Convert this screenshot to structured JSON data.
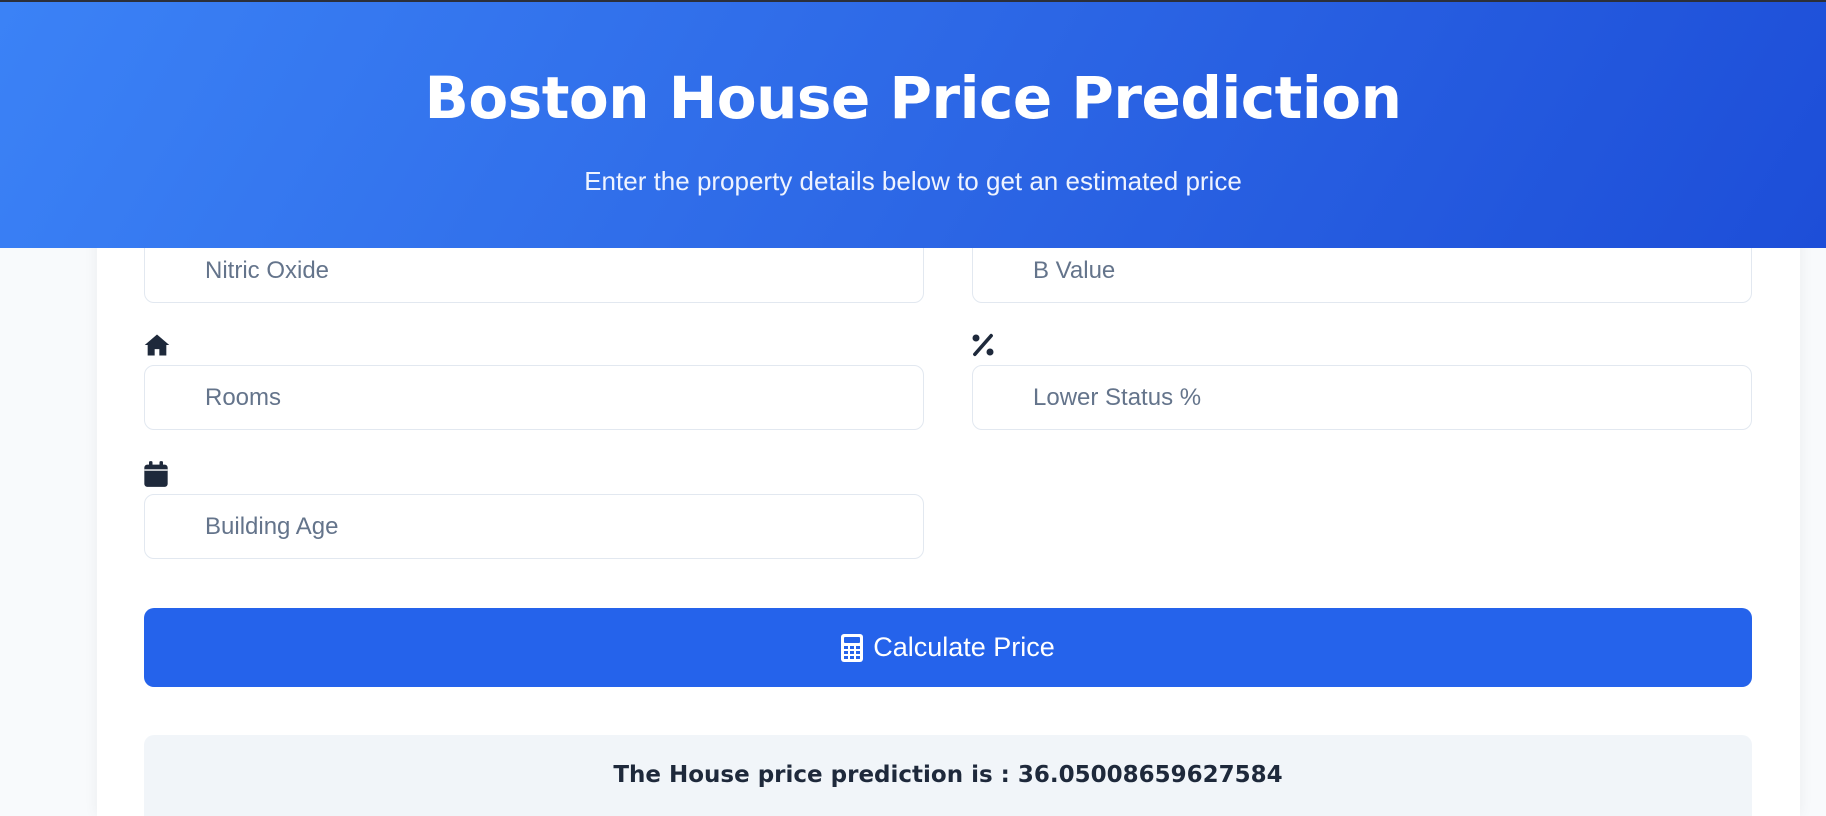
{
  "header": {
    "title": "Boston House Price Prediction",
    "subtitle": "Enter the property details below to get an estimated price"
  },
  "form": {
    "nitric_oxide": {
      "placeholder": "Nitric Oxide",
      "value": ""
    },
    "b_value": {
      "placeholder": "B Value",
      "value": ""
    },
    "rooms": {
      "placeholder": "Rooms",
      "value": "",
      "icon": "house-icon"
    },
    "lower_status": {
      "placeholder": "Lower Status %",
      "value": "",
      "icon": "percent-icon"
    },
    "building_age": {
      "placeholder": "Building Age",
      "value": "",
      "icon": "calendar-icon"
    }
  },
  "submit": {
    "label": "Calculate Price",
    "icon": "calculator-icon"
  },
  "result": {
    "text": "The House price prediction is : 36.05008659627584"
  },
  "colors": {
    "header_gradient_start": "#3b82f6",
    "header_gradient_end": "#1d4ed8",
    "button": "#2563eb",
    "result_background": "#f1f5f9",
    "placeholder_text": "#64748b",
    "icon": "#1e293b"
  }
}
